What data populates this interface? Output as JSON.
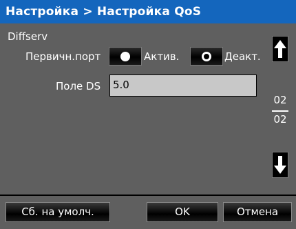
{
  "title": "Настройка > Настройка QoS",
  "section": "Diffserv",
  "primary_port": {
    "label": "Первичн.порт",
    "option_active": "Актив.",
    "option_inactive": "Деакт.",
    "selected": "Актив."
  },
  "ds_field": {
    "label": "Поле DS",
    "value": "5.0"
  },
  "pagination": {
    "current": "02",
    "total": "02"
  },
  "buttons": {
    "reset": "Сб. на умолч.",
    "ok": "OK",
    "cancel": "Отмена"
  },
  "icons": {
    "scroll_up": "arrow-up-icon",
    "scroll_down": "arrow-down-icon"
  }
}
